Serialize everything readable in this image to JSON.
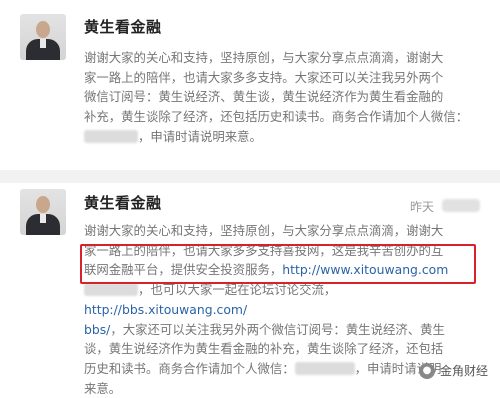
{
  "posts": [
    {
      "author": "黄生看金融",
      "text": {
        "l1": "谢谢大家的关心和支持，坚持原创，与大家分享点点滴滴，谢谢大",
        "l2": "家一路上的陪伴，也请大家多多支持。大家还可以关注我另外两个",
        "l3": "微信订阅号：黄生说经济、黄生谈，黄生说经济作为黄生看金融的",
        "l4": "补充，黄生谈除了经济，还包括历史和读书。商务合作请加个人微信：",
        "l5": "，申请时请说明来意。"
      }
    },
    {
      "author": "黄生看金融",
      "time": "昨天",
      "text": {
        "l1": "谢谢大家的关心和支持，坚持原创，与大家分享点点滴滴，谢谢大",
        "l2": "家一路上的陪伴，也请大家多多支持喜投网，这是我辛苦创办的互",
        "l3_pre": "联网金融平台，提供安全投资服务，",
        "l3_link": "http://www.xitouwang.com",
        "l4_pre": "，也可以大家一起在论坛讨论交流，",
        "l4_link": "http://bbs.xitouwang.com/",
        "l5_link": "bbs/",
        "l5_post": "，大家还可以关注我另外两个微信订阅号：黄生说经济、黄生",
        "l6": "谈，黄生说经济作为黄生看金融的补充，黄生谈除了经济，还包括",
        "l7": "历史和读书。商务合作请加个人微信：",
        "l7_post": "，申请时请说明",
        "l8": "来意。"
      }
    }
  ],
  "watermark": {
    "label": "金角财经",
    "icon": "wechat-icon"
  },
  "colors": {
    "highlight": "#d6232b",
    "link": "#2a63a8"
  }
}
